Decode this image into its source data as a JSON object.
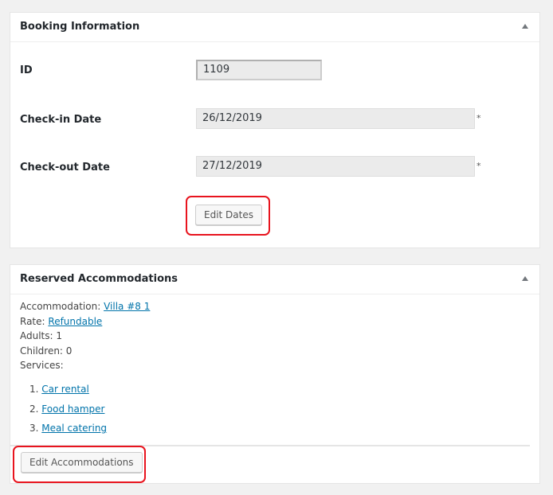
{
  "booking_info": {
    "title": "Booking Information",
    "toggle_icon": "triangle-up-icon",
    "id_label": "ID",
    "id_value": "1109",
    "checkin_label": "Check-in Date",
    "checkin_value": "26/12/2019",
    "checkout_label": "Check-out Date",
    "checkout_value": "27/12/2019",
    "required_mark": "*",
    "edit_dates_label": "Edit Dates"
  },
  "reserved": {
    "title": "Reserved Accommodations",
    "toggle_icon": "triangle-up-icon",
    "accommodation_label": "Accommodation:",
    "accommodation_value": "Villa #8 1",
    "rate_label": "Rate:",
    "rate_value": "Refundable",
    "adults": "Adults: 1",
    "children": "Children: 0",
    "services_label": "Services:",
    "services": [
      {
        "num": "1.",
        "name": "Car rental"
      },
      {
        "num": "2.",
        "name": "Food hamper"
      },
      {
        "num": "3.",
        "name": "Meal catering"
      }
    ],
    "edit_accommodations_label": "Edit Accommodations"
  },
  "colors": {
    "link": "#0073aa",
    "highlight": "#e8141e"
  }
}
